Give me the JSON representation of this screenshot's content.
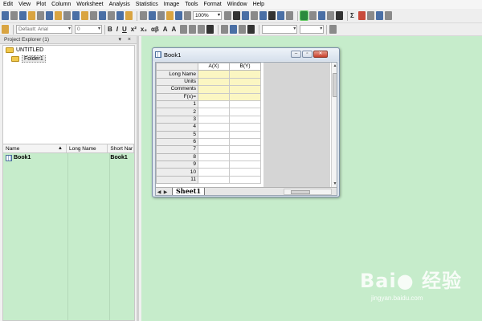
{
  "menu": [
    "Edit",
    "View",
    "Plot",
    "Column",
    "Worksheet",
    "Analysis",
    "Statistics",
    "Image",
    "Tools",
    "Format",
    "Window",
    "Help"
  ],
  "toolbar": {
    "zoom": "100%",
    "font": "Default: Arial",
    "font_size": "0"
  },
  "project_explorer": {
    "title": "Project Explorer (1)",
    "controls": "▾ ×",
    "root": "UNTITLED",
    "folder": "Folder1",
    "columns": [
      "Name",
      "Long Name",
      "Short Nar"
    ],
    "items": [
      {
        "name": "Book1",
        "long_name": "",
        "short_name": "Book1"
      }
    ]
  },
  "workbook": {
    "title": "Book1",
    "columns": [
      "A(X)",
      "B(Y)"
    ],
    "meta_rows": [
      "Long Name",
      "Units",
      "Comments",
      "F(x)="
    ],
    "rows": [
      "1",
      "2",
      "3",
      "4",
      "5",
      "6",
      "7",
      "8",
      "9",
      "10",
      "11"
    ],
    "sheet_tab": "Sheet1"
  },
  "watermark": {
    "brand": "Bai● 经验",
    "url": "jingyan.baidu.com"
  }
}
